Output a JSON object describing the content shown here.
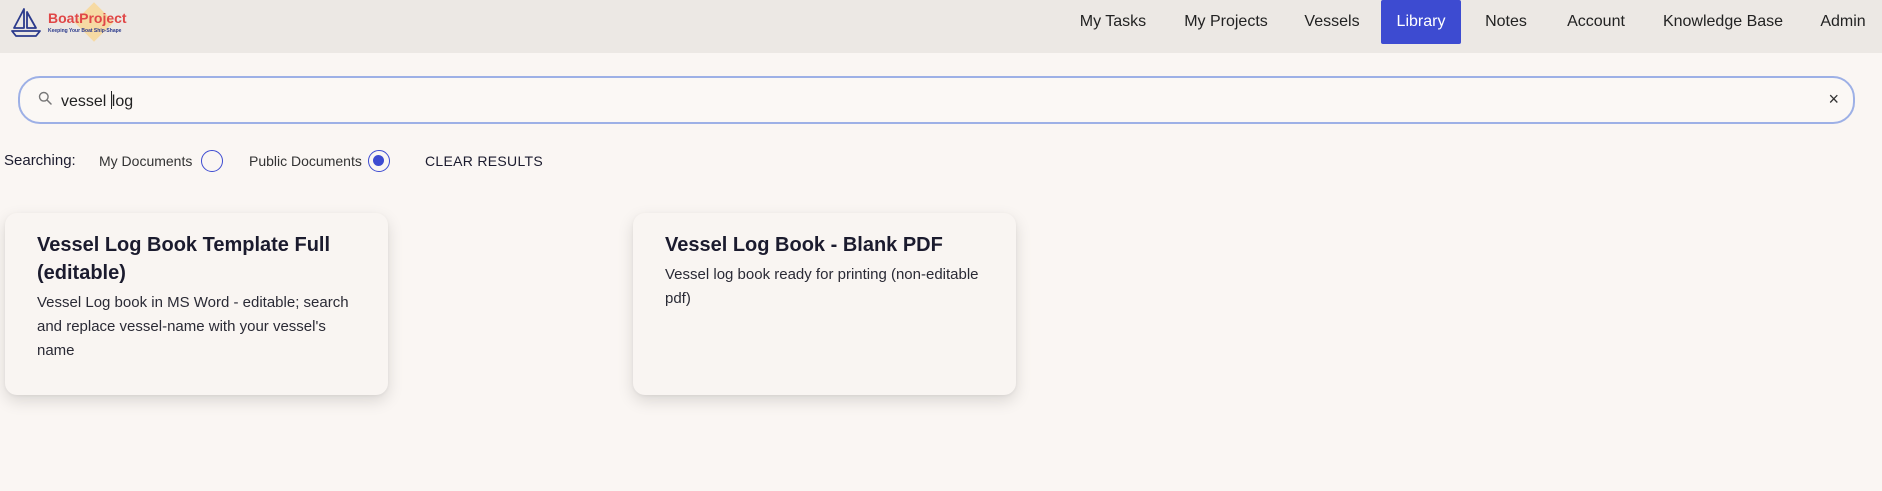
{
  "brand": {
    "title": "BoatProject",
    "tagline": "Keeping Your Boat Ship-Shape"
  },
  "nav": {
    "items": [
      {
        "label": "My Tasks"
      },
      {
        "label": "My Projects"
      },
      {
        "label": "Vessels"
      },
      {
        "label": "Library",
        "active": true
      },
      {
        "label": "Notes"
      },
      {
        "label": "Account"
      },
      {
        "label": "Knowledge Base"
      },
      {
        "label": "Admin"
      }
    ]
  },
  "search": {
    "value_before_caret": "vessel ",
    "value_after_caret": "log",
    "clear_icon": "×"
  },
  "filters": {
    "label": "Searching:",
    "my_documents": {
      "label": "My Documents",
      "selected": false
    },
    "public_documents": {
      "label": "Public Documents",
      "selected": true
    },
    "clear_results": "CLEAR RESULTS"
  },
  "results": [
    {
      "title": "Vessel Log Book Template Full (editable)",
      "description": "Vessel Log book in MS Word - editable; search and replace vessel-name with your vessel's name"
    },
    {
      "title": "Vessel Log Book - Blank PDF",
      "description": "Vessel log book ready for printing (non-editable pdf)"
    }
  ],
  "colors": {
    "accent": "#3d4bd1",
    "header_bg": "#ece8e4",
    "page_bg": "#faf6f3",
    "brand_red": "#e04747"
  }
}
